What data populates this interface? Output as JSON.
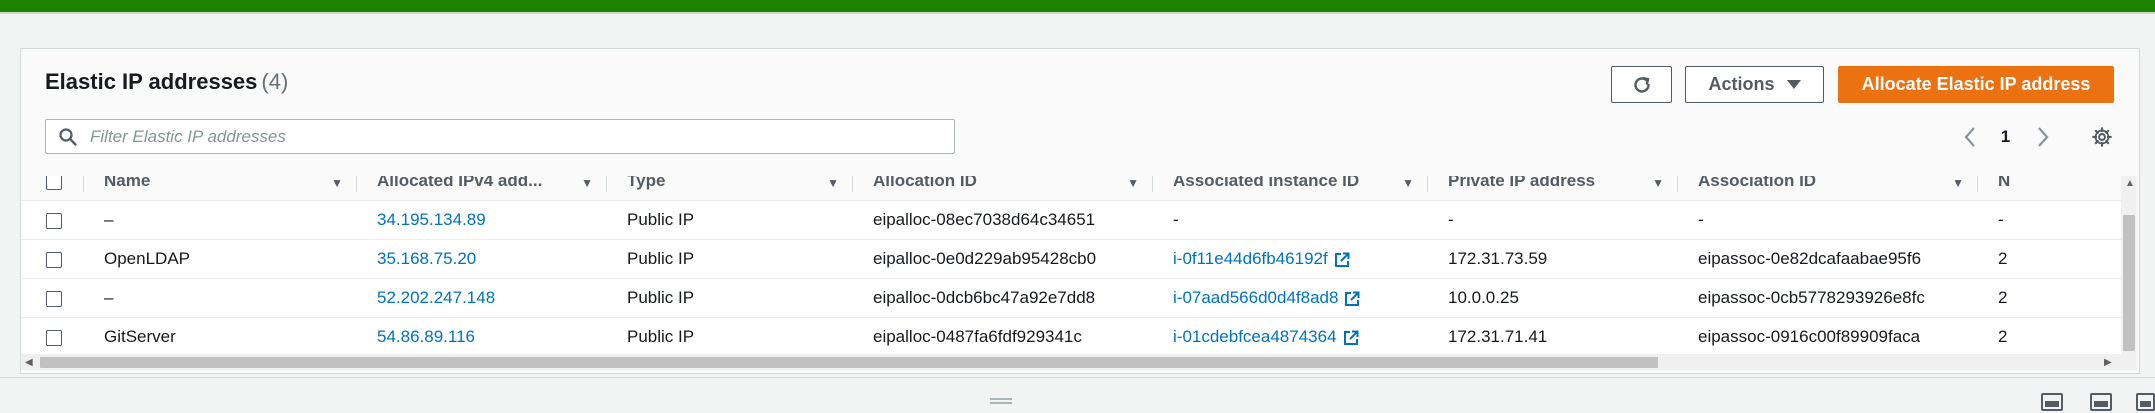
{
  "header": {
    "title": "Elastic IP addresses",
    "count": "(4)"
  },
  "toolbar": {
    "refresh_icon": "refresh-icon",
    "actions_label": "Actions",
    "allocate_label": "Allocate Elastic IP address"
  },
  "search": {
    "placeholder": "Filter Elastic IP addresses",
    "value": ""
  },
  "pagination": {
    "page": "1"
  },
  "table": {
    "columns": [
      "Name",
      "Allocated IPv4 add...",
      "Type",
      "Allocation ID",
      "Associated instance ID",
      "Private IP address",
      "Association ID",
      "N"
    ],
    "rows": [
      {
        "name": "–",
        "ip": "34.195.134.89",
        "type": "Public IP",
        "allocation_id": "eipalloc-08ec7038d64c34651",
        "instance_id": "-",
        "private_ip": "-",
        "association_id": "-",
        "extra": "-"
      },
      {
        "name": "OpenLDAP",
        "ip": "35.168.75.20",
        "type": "Public IP",
        "allocation_id": "eipalloc-0e0d229ab95428cb0",
        "instance_id": "i-0f11e44d6fb46192f",
        "private_ip": "172.31.73.59",
        "association_id": "eipassoc-0e82dcafaabae95f6",
        "extra": "2"
      },
      {
        "name": "–",
        "ip": "52.202.247.148",
        "type": "Public IP",
        "allocation_id": "eipalloc-0dcb6bc47a92e7dd8",
        "instance_id": "i-07aad566d0d4f8ad8",
        "private_ip": "10.0.0.25",
        "association_id": "eipassoc-0cb5778293926e8fc",
        "extra": "2"
      },
      {
        "name": "GitServer",
        "ip": "54.86.89.116",
        "type": "Public IP",
        "allocation_id": "eipalloc-0487fa6fdf929341c",
        "instance_id": "i-01cdebfcea4874364",
        "private_ip": "172.31.71.41",
        "association_id": "eipassoc-0916c00f89909faca",
        "extra": "2"
      }
    ]
  },
  "colors": {
    "top_bar": "#1d8102",
    "primary_button": "#ec7211",
    "link": "#0073bb"
  }
}
